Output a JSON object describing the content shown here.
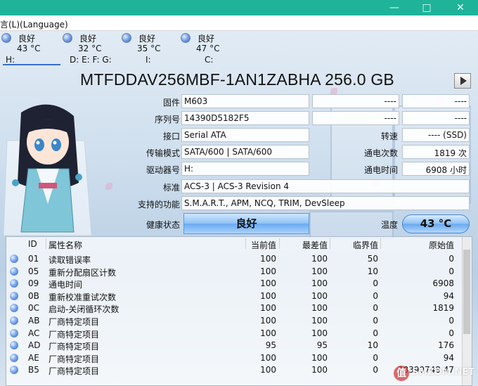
{
  "menu": {
    "language_label": "言(L)(Language)"
  },
  "drives": [
    {
      "status": "良好",
      "temp": "43 °C",
      "letters": "H:",
      "active": true
    },
    {
      "status": "良好",
      "temp": "32 °C",
      "letters": "D: E: F: G:"
    },
    {
      "status": "良好",
      "temp": "35 °C",
      "letters": "I:"
    },
    {
      "status": "良好",
      "temp": "47 °C",
      "letters": "C:"
    }
  ],
  "model_title": "MTFDDAV256MBF-1AN1ZABHA 256.0 GB",
  "info": {
    "firmware_label": "固件",
    "firmware": "M603",
    "serial_label": "序列号",
    "serial": "14390D5182F5",
    "interface_label": "接口",
    "interface": "Serial ATA",
    "transfer_label": "传输模式",
    "transfer": "SATA/600 | SATA/600",
    "drive_letter_label": "驱动器号",
    "drive_letter": "H:",
    "standard_label": "标准",
    "standard": "ACS-3 | ACS-3 Revision 4",
    "features_label": "支持的功能",
    "features": "S.M.A.R.T., APM, NCQ, TRIM, DevSleep",
    "health_label": "健康状态",
    "health": "良好",
    "right_top_1": "----",
    "right_top_2": "----",
    "right_top_3": "----",
    "right_top_4": "----",
    "rotation_label": "转速",
    "rotation": "---- (SSD)",
    "power_count_label": "通电次数",
    "power_count": "1819 次",
    "power_hours_label": "通电时间",
    "power_hours": "6908 小时",
    "temp_label": "温度",
    "temp": "43 °C"
  },
  "smart": {
    "headers": {
      "id": "ID",
      "name": "属性名称",
      "current": "当前值",
      "worst": "最差值",
      "threshold": "临界值",
      "raw": "原始值"
    },
    "rows": [
      {
        "id": "01",
        "name": "读取错误率",
        "current": "100",
        "worst": "100",
        "threshold": "50",
        "raw": "0"
      },
      {
        "id": "05",
        "name": "重新分配扇区计数",
        "current": "100",
        "worst": "100",
        "threshold": "10",
        "raw": "0"
      },
      {
        "id": "09",
        "name": "通电时间",
        "current": "100",
        "worst": "100",
        "threshold": "0",
        "raw": "6908"
      },
      {
        "id": "0B",
        "name": "重新校准重试次数",
        "current": "100",
        "worst": "100",
        "threshold": "0",
        "raw": "94"
      },
      {
        "id": "0C",
        "name": "启动-关闭循环次数",
        "current": "100",
        "worst": "100",
        "threshold": "0",
        "raw": "1819"
      },
      {
        "id": "AB",
        "name": "厂商特定项目",
        "current": "100",
        "worst": "100",
        "threshold": "0",
        "raw": "0"
      },
      {
        "id": "AC",
        "name": "厂商特定项目",
        "current": "100",
        "worst": "100",
        "threshold": "0",
        "raw": "0"
      },
      {
        "id": "AD",
        "name": "厂商特定项目",
        "current": "95",
        "worst": "95",
        "threshold": "10",
        "raw": "176"
      },
      {
        "id": "AE",
        "name": "厂商特定项目",
        "current": "100",
        "worst": "100",
        "threshold": "0",
        "raw": "94"
      },
      {
        "id": "B5",
        "name": "厂商特定项目",
        "current": "100",
        "worst": "100",
        "threshold": "0",
        "raw": "38390748 47"
      }
    ]
  },
  "watermark": {
    "badge": "值",
    "text": "SMZDM.NET"
  }
}
